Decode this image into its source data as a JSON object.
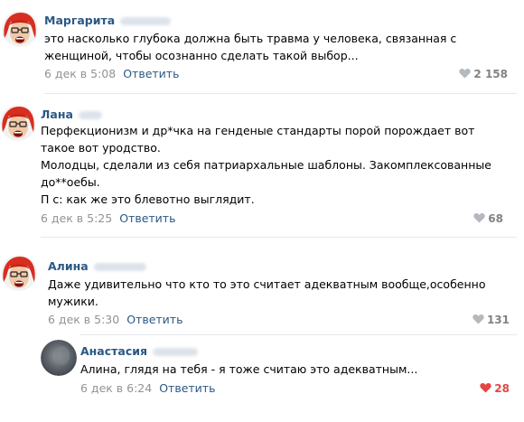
{
  "comments": [
    {
      "author": "Маргарита",
      "avatar": "red-haired-woman-cartoon",
      "lines": [
        "это насколько глубока должна быть травма у человека, связанная с",
        "женщиной, чтобы осознанно сделать такой выбор..."
      ],
      "date": "6 дек в 5:08",
      "reply_label": "Ответить",
      "likes": "2 158",
      "liked": false
    },
    {
      "author": "Лана",
      "avatar": "red-haired-woman-cartoon",
      "lines": [
        "Перфекционизм и др*чка на генденые стандарты порой порождает вот",
        "такое вот уродство.",
        "Молодцы, сделали из себя патриархальные шаблоны. Закомплексованные",
        "до**оебы.",
        "П с: как же это блевотно выглядит."
      ],
      "date": "6 дек в 5:25",
      "reply_label": "Ответить",
      "likes": "68",
      "liked": false
    },
    {
      "author": "Алина",
      "avatar": "red-haired-woman-cartoon",
      "lines": [
        "Даже удивительно что кто то это считает адекватным вообще,особенно",
        "мужики."
      ],
      "date": "6 дек в 5:30",
      "reply_label": "Ответить",
      "likes": "131",
      "liked": false
    },
    {
      "author": "Анастасия",
      "avatar": "blurred-photo",
      "lines": [
        "Алина, глядя на тебя - я тоже считаю это адекватным..."
      ],
      "date": "6 дек в 6:24",
      "reply_label": "Ответить",
      "likes": "28",
      "liked": true
    }
  ],
  "colors": {
    "link": "#2a5885",
    "meta": "#939393",
    "like": "#828282",
    "liked": "#e64646",
    "divider": "#e7e8ec"
  }
}
